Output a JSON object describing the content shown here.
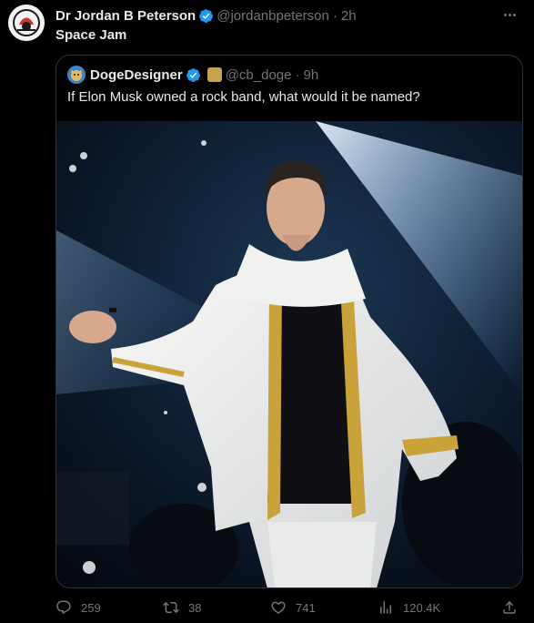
{
  "tweet": {
    "author_name": "Dr Jordan B Peterson",
    "author_handle": "@jordanbpeterson",
    "separator": "·",
    "time": "2h",
    "text": "Space Jam"
  },
  "quote": {
    "author_name": "DogeDesigner",
    "author_handle": "@cb_doge",
    "separator": "·",
    "time": "9h",
    "text": "If Elon Musk owned a rock band, what would it be named?"
  },
  "actions": {
    "replies": "259",
    "retweets": "38",
    "likes": "741",
    "views": "120.4K"
  },
  "colors": {
    "background": "#000000",
    "text_primary": "#e7e9ea",
    "text_secondary": "#71767b",
    "verified_blue": "#1d9bf0",
    "border": "#2f3336"
  },
  "icons": {
    "avatar": "avatar-icon",
    "verified": "verified-badge-icon",
    "more": "more-icon",
    "reply": "reply-icon",
    "retweet": "retweet-icon",
    "like": "like-icon",
    "views": "views-icon",
    "share": "share-icon"
  }
}
